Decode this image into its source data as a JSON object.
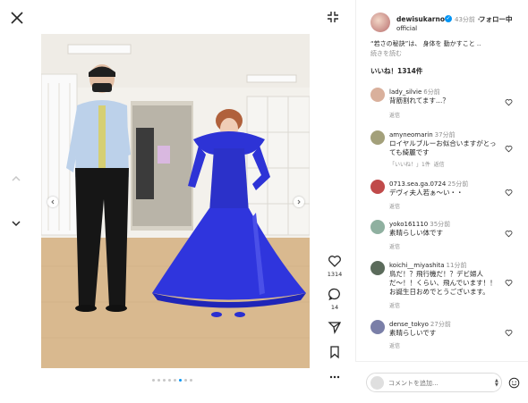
{
  "post": {
    "username": "dewisukarno",
    "subname": "official",
    "verified_mark": "✓",
    "time": "43分前",
    "separator": "•",
    "follow_label": "フォロー中",
    "caption": "“若さの秘訣”は、 身体を 動かすこと ..",
    "read_more": "続きを読む",
    "likes": "いいね！1314件",
    "like_count": "1314",
    "comment_count": "14"
  },
  "comments": [
    {
      "user": "lady_silvie",
      "time": "6分前",
      "text": "背筋割れてます…？",
      "reply": "返信",
      "reply_extra": "",
      "avatar_color": "#d9b09c"
    },
    {
      "user": "amyneomarin",
      "time": "37分前",
      "text": "ロイヤルブルーお似合いますがとっても綺麗です",
      "reply": "返信",
      "reply_extra": "「いいね！」1件",
      "avatar_color": "#a3a07a"
    },
    {
      "user": "0713.sea.ga.0724",
      "time": "25分前",
      "text": "デヴィ夫人若ぁ〜い・・",
      "reply": "返信",
      "reply_extra": "",
      "avatar_color": "#c04a4a"
    },
    {
      "user": "yoko161110",
      "time": "35分前",
      "text": "素晴らしい体です",
      "reply": "返信",
      "reply_extra": "",
      "avatar_color": "#8fb0a0"
    },
    {
      "user": "koichi__miyashita",
      "time": "11分前",
      "text": "鳥だ！？飛行機だ！？デビ婦人だ〜！！くらい、飛んでいます！！お誕生日おめでとうございます。",
      "reply": "返信",
      "reply_extra": "",
      "avatar_color": "#5b6b5b"
    },
    {
      "user": "dense_tokyo",
      "time": "27分前",
      "text": "素晴らしいです",
      "reply": "返信",
      "reply_extra": "",
      "avatar_color": "#7a7fa8"
    }
  ],
  "footer": {
    "comment_placeholder": "コメントを追加..."
  },
  "carousel": {
    "total_dots": 8,
    "active_index": 5
  },
  "colors": {
    "accent": "#0095f6",
    "dress": "#2a2fd0",
    "floor": "#d9b98f"
  },
  "icons": {
    "close": "close-icon",
    "shrink": "collapse-icon",
    "heart": "heart-icon",
    "comment": "comment-icon",
    "share": "send-icon",
    "save": "bookmark-icon",
    "more": "more-icon",
    "emoji": "emoji-icon"
  }
}
